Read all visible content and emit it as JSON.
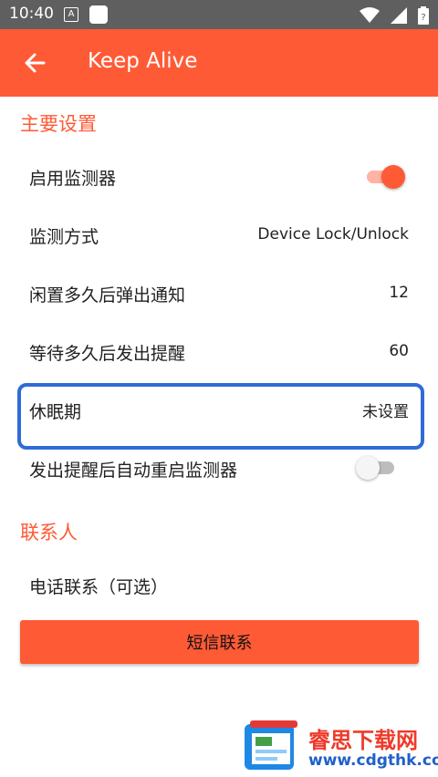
{
  "status_bar": {
    "time": "10:40",
    "notif_letter": "A"
  },
  "app_bar": {
    "title": "Keep Alive"
  },
  "sections": {
    "main_settings": "主要设置",
    "contacts": "联系人"
  },
  "settings": {
    "enable_monitor": {
      "label": "启用监测器",
      "enabled": true
    },
    "monitor_method": {
      "label": "监测方式",
      "value": "Device Lock/Unlock"
    },
    "idle_notify": {
      "label": "闲置多久后弹出通知",
      "value": "12"
    },
    "wait_alert": {
      "label": "等待多久后发出提醒",
      "value": "60"
    },
    "sleep_period": {
      "label": "休眠期",
      "value": "未设置"
    },
    "auto_restart": {
      "label": "发出提醒后自动重启监测器",
      "enabled": false
    }
  },
  "contacts": {
    "phone_label": "电话联系（可选）",
    "sms_button": "短信联系"
  },
  "watermark": {
    "title": "睿思下载网",
    "url": "www.cdgthk.com"
  },
  "colors": {
    "accent": "#ff5a36",
    "highlight": "#2f6bd8",
    "status_bar": "#5f5f5f"
  }
}
